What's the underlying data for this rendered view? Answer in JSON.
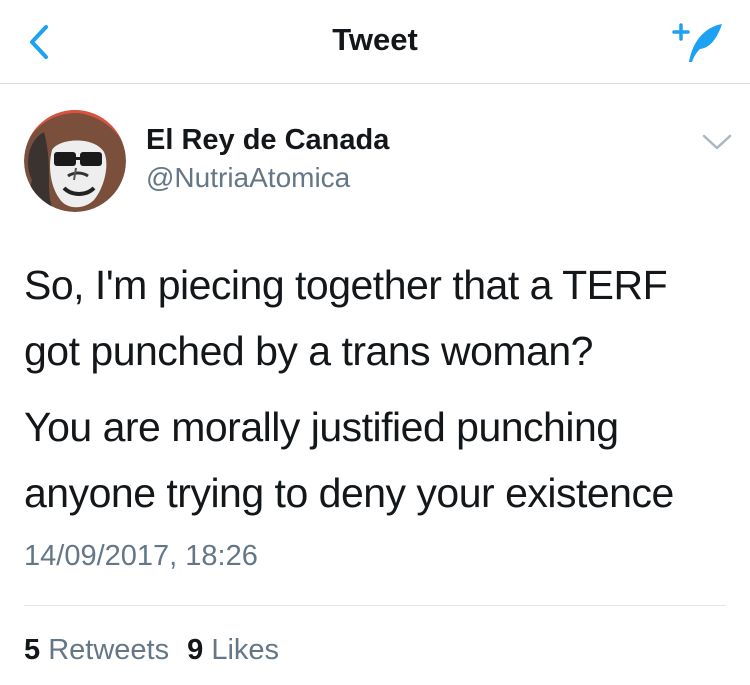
{
  "navbar": {
    "title": "Tweet",
    "back_icon": "chevron-left-icon",
    "compose_icon": "compose-feather-icon",
    "accent": "#1da1f2"
  },
  "tweet": {
    "author": {
      "display_name": "El Rey de Canada",
      "handle": "@NutriaAtomica"
    },
    "text": [
      "So, I'm piecing together that a TERF got punched by a trans woman?",
      "You are morally justified punching anyone trying to deny your existence"
    ],
    "timestamp": "14/09/2017, 18:26",
    "retweets": {
      "count": "5",
      "label": "Retweets"
    },
    "likes": {
      "count": "9",
      "label": "Likes"
    }
  }
}
